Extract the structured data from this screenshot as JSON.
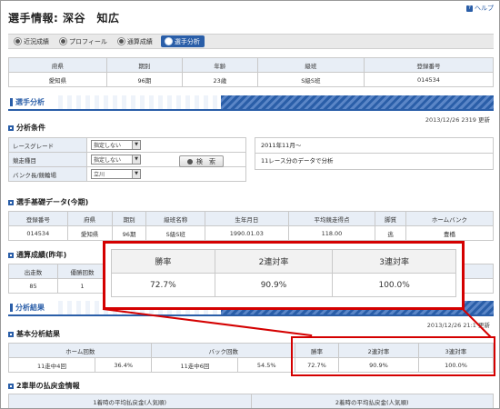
{
  "help": {
    "label": "ヘルプ"
  },
  "page": {
    "title": "選手情報: 深谷　知広"
  },
  "tabs": [
    {
      "label": "近況成績",
      "active": false
    },
    {
      "label": "プロフィール",
      "active": false
    },
    {
      "label": "通算成績",
      "active": false
    },
    {
      "label": "選手分析",
      "active": true
    }
  ],
  "profile": {
    "headers": [
      "府県",
      "期別",
      "年齢",
      "級班",
      "登録番号"
    ],
    "values": [
      "愛知県",
      "96期",
      "23歳",
      "S級S班",
      "014534"
    ]
  },
  "analysis": {
    "section_label": "選手分析",
    "updated": "2013/12/26 2319 更新",
    "conditions": {
      "heading": "分析条件",
      "rows": [
        {
          "label": "レースグレード",
          "value": "指定しない"
        },
        {
          "label": "競走種目",
          "value": "指定しない"
        },
        {
          "label": "バンク長/競輪場",
          "value": "立川"
        }
      ],
      "search_label": "検　索",
      "info": [
        "2011年11月～",
        "11レース分のデータで分析"
      ]
    }
  },
  "basic": {
    "heading": "選手基礎データ(今期)",
    "headers": [
      "登録番号",
      "府県",
      "期別",
      "級班名称",
      "生年月日",
      "平均競走得点",
      "脚質",
      "ホームバンク"
    ],
    "values": [
      "014534",
      "愛知県",
      "96期",
      "S級S班",
      "1990.01.03",
      "118.00",
      "逃",
      "豊橋"
    ]
  },
  "totals": {
    "heading": "通算成績(昨年)",
    "headers": [
      "出走数",
      "優勝回数"
    ],
    "values": [
      "85",
      "1"
    ]
  },
  "zoom": {
    "headers": [
      "勝率",
      "2連対率",
      "3連対率"
    ],
    "values": [
      "72.7%",
      "90.9%",
      "100.0%"
    ]
  },
  "results": {
    "section_label": "分析結果",
    "updated": "2013/12/26 21:1 更新",
    "basic_heading": "基本分析結果",
    "headers": [
      "ホーム回数",
      "バック回数",
      "勝率",
      "2連対率",
      "3連対率"
    ],
    "values": [
      "11走中4回",
      "36.4%",
      "11走中6回",
      "54.5%",
      "72.7%",
      "90.9%",
      "100.0%"
    ]
  },
  "payout": {
    "heading": "2車単の払戻金情報",
    "headers": [
      "1着時の平均払戻金(人気順)",
      "2着時の平均払戻金(人気順)"
    ]
  },
  "colors": {
    "accent": "#2a5ea8",
    "highlight": "#d40000"
  }
}
